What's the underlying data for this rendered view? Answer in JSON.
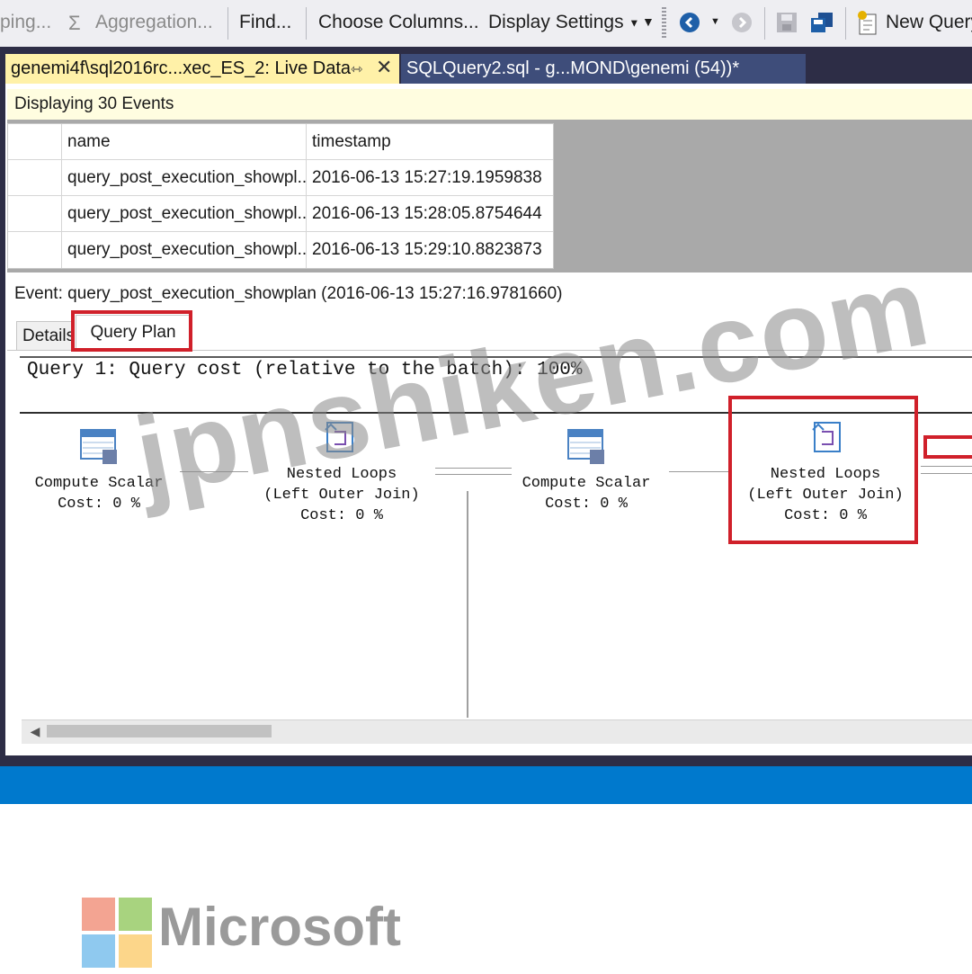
{
  "toolbar": {
    "grouping_label": "ping...",
    "aggregation_label": "Aggregation...",
    "find_label": "Find...",
    "choose_columns_label": "Choose Columns...",
    "display_settings_label": "Display Settings",
    "new_query_label": "New Query"
  },
  "tabs": [
    {
      "label": "genemi4f\\sql2016rc...xec_ES_2: Live Data",
      "active": true
    },
    {
      "label": "SQLQuery2.sql - g...MOND\\genemi (54))*",
      "active": false
    }
  ],
  "live_data": {
    "display_count_text": "Displaying 30 Events",
    "columns": [
      "name",
      "timestamp"
    ],
    "rows": [
      {
        "name": "query_post_execution_showpl...",
        "timestamp": "2016-06-13 15:27:19.1959838"
      },
      {
        "name": "query_post_execution_showpl...",
        "timestamp": "2016-06-13 15:28:05.8754644"
      },
      {
        "name": "query_post_execution_showpl...",
        "timestamp": "2016-06-13 15:29:10.8823873"
      }
    ]
  },
  "event": {
    "line": "Event: query_post_execution_showplan (2016-06-13 15:27:16.9781660)"
  },
  "detail_tabs": {
    "details_label": "Details",
    "query_plan_label": "Query Plan",
    "active": "Query Plan"
  },
  "plan": {
    "header": "Query 1: Query cost (relative to the batch): 100%",
    "operators": [
      {
        "name": "Compute Scalar",
        "join": "",
        "cost": "Cost: 0 %",
        "icon": "compute-scalar-icon"
      },
      {
        "name": "Nested Loops",
        "join": "(Left Outer Join)",
        "cost": "Cost: 0 %",
        "icon": "nested-loops-icon"
      },
      {
        "name": "Compute Scalar",
        "join": "",
        "cost": "Cost: 0 %",
        "icon": "compute-scalar-icon"
      },
      {
        "name": "Nested Loops",
        "join": "(Left Outer Join)",
        "cost": "Cost: 0 %",
        "icon": "nested-loops-icon"
      }
    ]
  },
  "watermark": "jpnshiken.com",
  "brand": {
    "name": "Microsoft",
    "colors": [
      "#f25022",
      "#7fba00",
      "#00a4ef",
      "#ffb900"
    ]
  },
  "colors": {
    "highlight": "#d0202a",
    "status_bar": "#0079cd",
    "active_tab": "#fff1a8"
  }
}
